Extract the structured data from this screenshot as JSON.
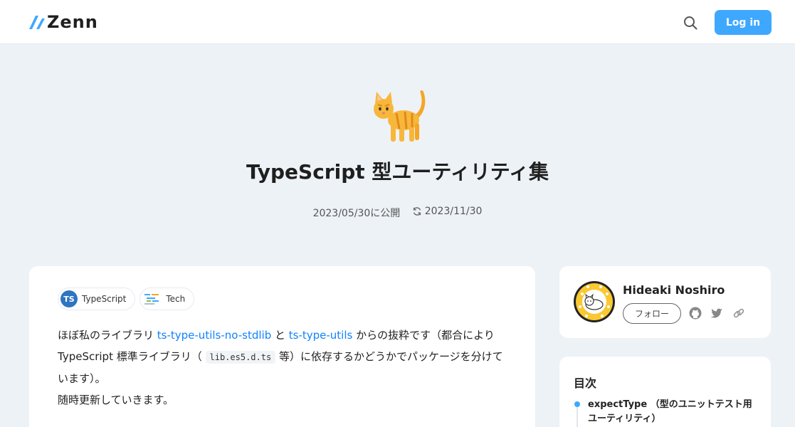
{
  "header": {
    "logo_text": "Zenn",
    "login_label": "Log in",
    "brand_color": "#3ea8ff"
  },
  "article": {
    "emoji": "cat-emoji",
    "title": "TypeScript 型ユーティリティ集",
    "published": "2023/05/30に公開",
    "updated": "2023/11/30",
    "topics": [
      {
        "label": "TypeScript",
        "icon": "ts-badge",
        "badge": "TS"
      },
      {
        "label": "Tech",
        "icon": "tech-icon"
      }
    ],
    "body": {
      "p1_prefix": "ほぼ私のライブラリ ",
      "link1": "ts-type-utils-no-stdlib",
      "p1_mid": " と ",
      "link2": "ts-type-utils",
      "p1_suffix": " からの抜粋です（都合により TypeScript 標準ライブラリ（ ",
      "code": "lib.es5.d.ts",
      "p1_end": " 等）に依存するかどうかでパッケージを分けています）。",
      "p2": "随時更新していきます。"
    }
  },
  "author": {
    "name": "Hideaki Noshiro",
    "follow_label": "フォロー",
    "social_icons": [
      "github-icon",
      "twitter-icon",
      "link-icon"
    ]
  },
  "toc": {
    "title": "目次",
    "items": [
      "expectType （型のユニットテスト用ユーティリティ）"
    ]
  }
}
